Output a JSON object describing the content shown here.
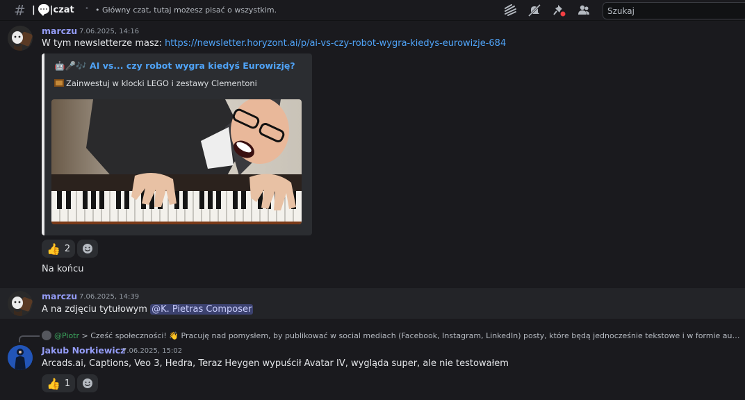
{
  "header": {
    "channel_name": "czat",
    "topic": "• Główny czat, tutaj możesz pisać o wszystkim.",
    "search_placeholder": "Szukaj"
  },
  "messages": [
    {
      "author": "marczu",
      "timestamp": "7.06.2025, 14:16",
      "text_prefix": "W tym newsletterze masz: ",
      "link": "https://newsletter.horyzont.ai/p/ai-vs-czy-robot-wygra-kiedys-eurowizje-684",
      "embed": {
        "title": "🤖🎤🎶 AI vs... czy robot wygra kiedyś Eurowizję?",
        "description": "Zainwestuj w klocki LEGO i zestawy Clementoni"
      },
      "reaction_count": "2"
    },
    {
      "text": "Na końcu"
    },
    {
      "author": "marczu",
      "timestamp": "7.06.2025, 14:39",
      "text_prefix": "A na zdjęciu tytułowym ",
      "mention": "@K. Pietras Composer"
    },
    {
      "reply_author": "@Piotr",
      "reply_text": " > Cześć społeczności! 👋  Pracuję nad pomysłem, by publikować w social mediach (Facebook, Instagram, LinkedIn) posty, które będą jednocześnie tekstowe i w formie audio-w...",
      "author": "Jakub Norkiewicz",
      "timestamp": "7.06.2025, 15:02",
      "text": "Arcads.ai, Captions, Veo 3, Hedra, Teraz Heygen wypuścił Avatar IV, wygląda super, ale nie testowałem",
      "reaction_count": "1"
    }
  ]
}
